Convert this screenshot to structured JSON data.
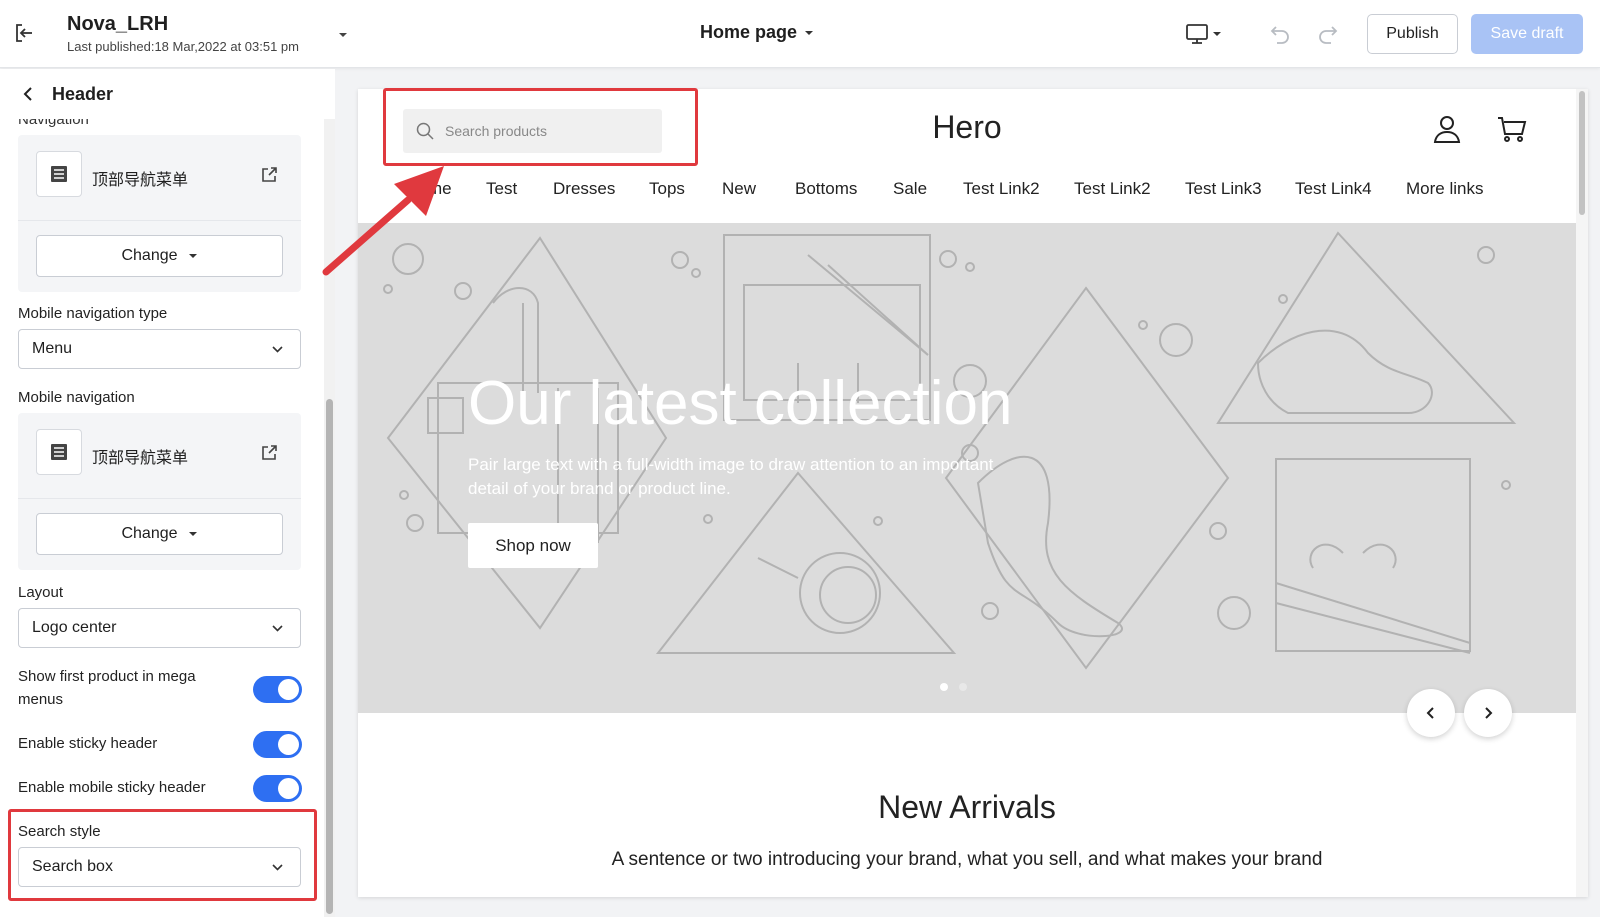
{
  "topbar": {
    "site_name": "Nova_LRH",
    "last_published": "Last published:18 Mar,2022 at 03:51 pm",
    "page_selector": "Home page",
    "publish_label": "Publish",
    "save_draft_label": "Save draft"
  },
  "sidebar": {
    "title": "Header",
    "navigation_label": "Navigation",
    "navigation_menu": "顶部导航菜单",
    "change_label": "Change",
    "mobile_nav_type_label": "Mobile navigation type",
    "mobile_nav_type_value": "Menu",
    "mobile_nav_label": "Mobile navigation",
    "mobile_nav_menu": "顶部导航菜单",
    "layout_label": "Layout",
    "layout_value": "Logo center",
    "toggles": [
      {
        "label": "Show first product in mega menus",
        "on": true
      },
      {
        "label": "Enable sticky header",
        "on": true
      },
      {
        "label": "Enable mobile sticky header",
        "on": true
      }
    ],
    "search_style_label": "Search style",
    "search_style_value": "Search box"
  },
  "preview": {
    "search_placeholder": "Search products",
    "logo": "Hero",
    "nav_items": [
      "me",
      "Test",
      "Dresses",
      "Tops",
      "New",
      "Bottoms",
      "Sale",
      "Test Link2",
      "Test Link2",
      "Test Link3",
      "Test Link4",
      "More links"
    ],
    "hero_title": "Our latest collection",
    "hero_text": "Pair large text with a full-width image to draw attention to an important detail of your brand or product line.",
    "hero_button": "Shop now",
    "section_title": "New Arrivals",
    "section_text": "A sentence or two introducing your brand, what you sell, and what makes your brand"
  },
  "colors": {
    "accent": "#2e6ff2",
    "highlight": "#e0393e",
    "save_disabled": "#a9c3f5",
    "hero_bg": "#dcdcdc"
  },
  "icons": {
    "exit": "exit-icon",
    "device": "desktop-icon",
    "undo": "undo-icon",
    "redo": "redo-icon",
    "search": "search-icon",
    "account": "user-icon",
    "cart": "cart-icon"
  }
}
